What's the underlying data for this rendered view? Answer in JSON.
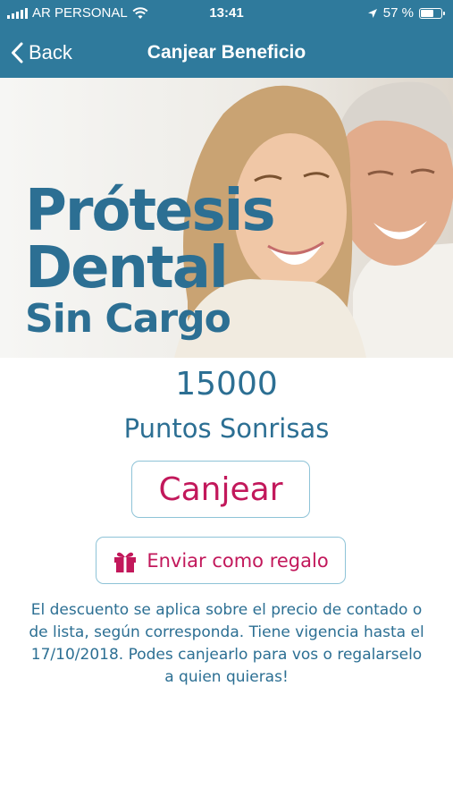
{
  "status_bar": {
    "carrier": "AR PERSONAL",
    "time": "13:41",
    "battery": "57 %",
    "battery_level": 0.57
  },
  "nav": {
    "back_label": "Back",
    "title": "Canjear Beneficio"
  },
  "hero": {
    "line1": "Prótesis",
    "line2": "Dental",
    "line3": "Sin Cargo"
  },
  "benefit": {
    "points": "15000",
    "points_label": "Puntos Sonrisas",
    "redeem_label": "Canjear",
    "gift_label": "Enviar como regalo",
    "description": "El descuento se aplica sobre el precio de contado o de lista, según corresponda. Tiene vigencia hasta el 17/10/2018. Podes canjearlo para vos o regalarselo a quien quieras!"
  },
  "colors": {
    "nav_bg": "#2f7a9c",
    "brand_text": "#2c6f93",
    "accent_pink": "#c2185b",
    "button_border": "#8ec3d7"
  },
  "icons": [
    "back-chevron-icon",
    "gift-icon",
    "wifi-icon",
    "location-arrow-icon",
    "battery-icon",
    "signal-icon"
  ]
}
